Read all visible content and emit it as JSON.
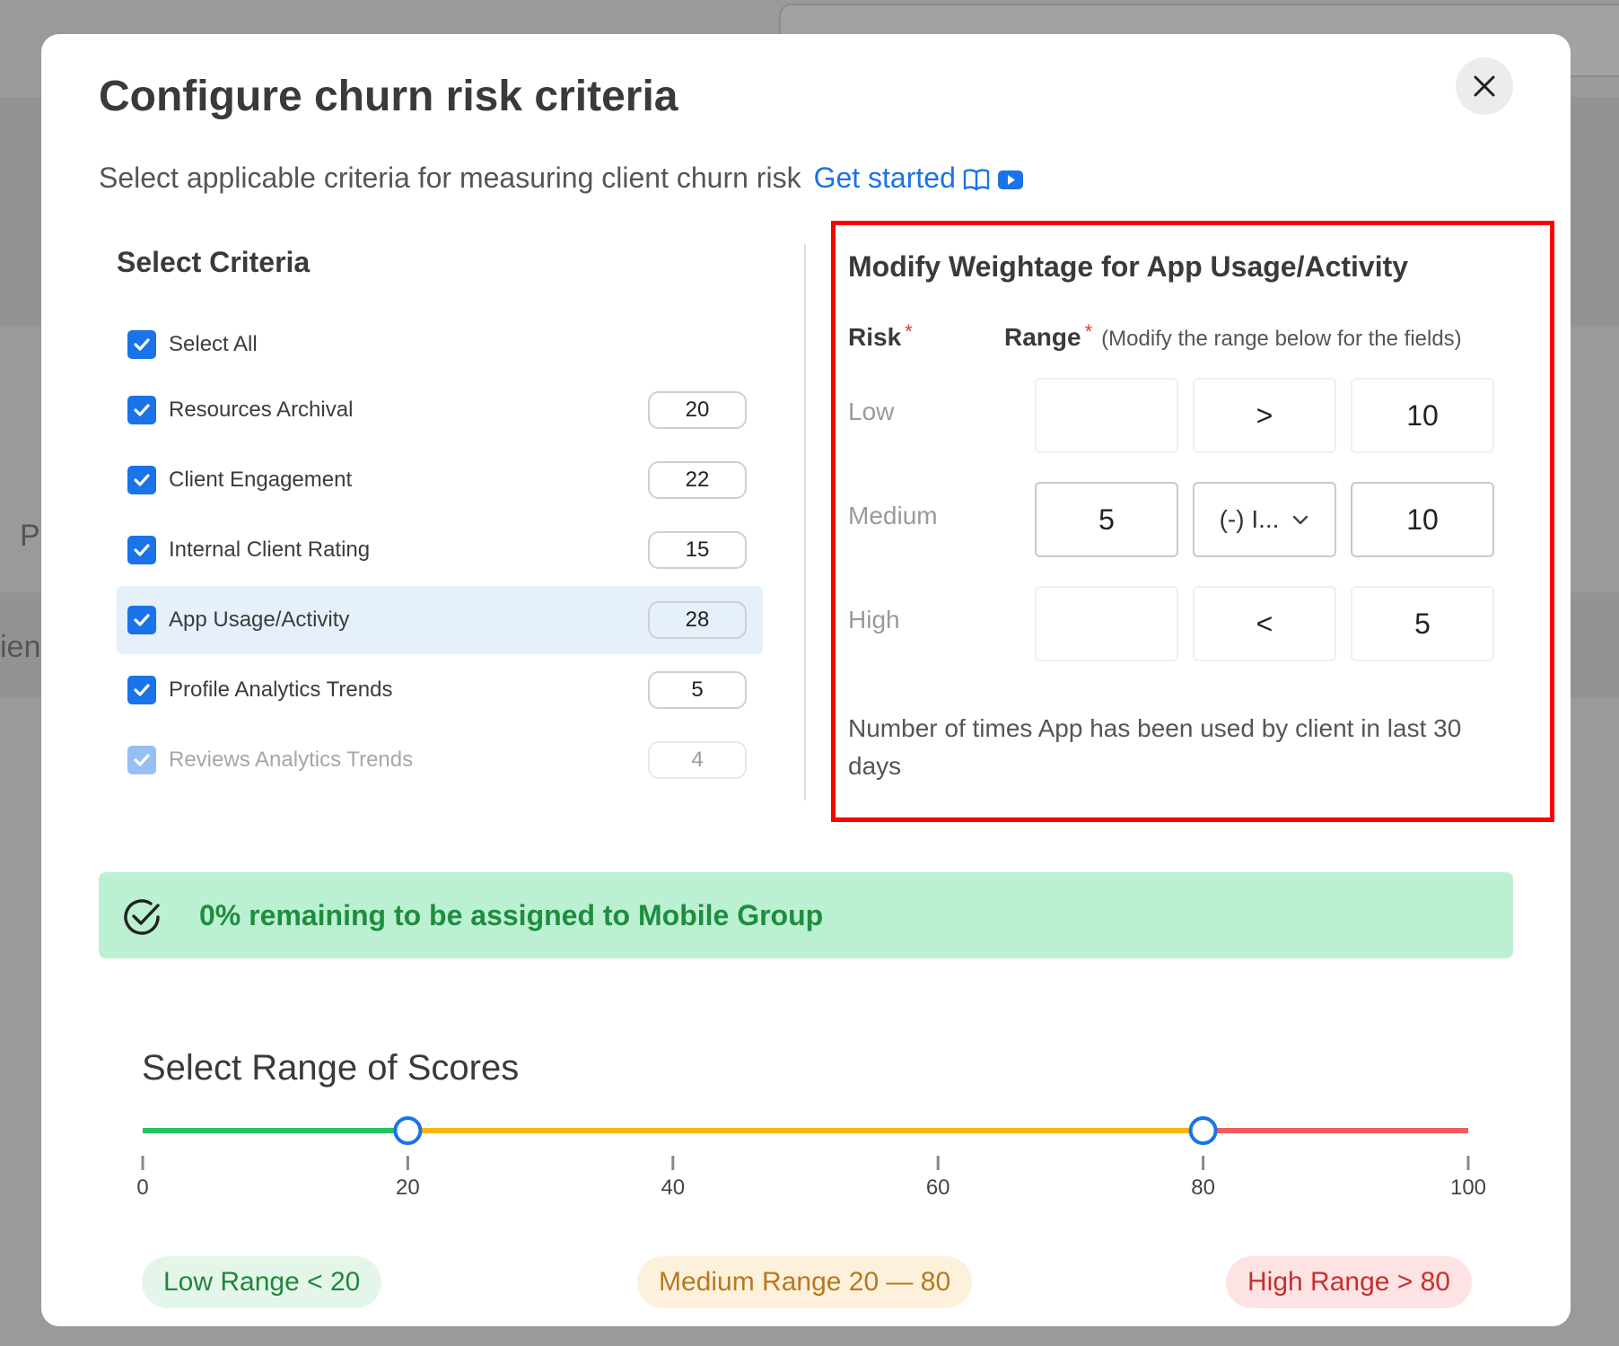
{
  "background": {
    "fragments": [
      "P",
      "ien"
    ]
  },
  "modal": {
    "title": "Configure churn risk criteria",
    "subtitle": "Select applicable criteria for measuring client churn risk",
    "get_started": "Get started",
    "close_icon": "close-icon",
    "book_icon": "book-icon",
    "video_icon": "video-play-icon"
  },
  "criteria": {
    "heading": "Select Criteria",
    "select_all": "Select All",
    "items": [
      {
        "label": "Resources Archival",
        "value": "20",
        "checked": true
      },
      {
        "label": "Client Engagement",
        "value": "22",
        "checked": true
      },
      {
        "label": "Internal Client Rating",
        "value": "15",
        "checked": true
      },
      {
        "label": "App Usage/Activity",
        "value": "28",
        "checked": true,
        "active": true
      },
      {
        "label": "Profile Analytics Trends",
        "value": "5",
        "checked": true
      },
      {
        "label": "Reviews Analytics Trends",
        "value": "4",
        "checked": true,
        "disabled": true
      }
    ]
  },
  "weightage": {
    "title": "Modify Weightage for App Usage/Activity",
    "risk_label": "Risk",
    "range_label": "Range",
    "required_mark": "*",
    "range_hint": "(Modify the range below for the fields)",
    "rows": [
      {
        "risk": "Low",
        "min": "",
        "operator": ">",
        "max": "10"
      },
      {
        "risk": "Medium",
        "min": "5",
        "operator": "(-) I...",
        "max": "10"
      },
      {
        "risk": "High",
        "min": "",
        "operator": "<",
        "max": "5"
      }
    ],
    "description": "Number of times App has been used by client in last 30 days"
  },
  "alert": {
    "text": "0% remaining to be assigned to Mobile Group",
    "icon": "check-circle-icon",
    "color": "#1e8e3e"
  },
  "scores": {
    "heading": "Select Range of Scores",
    "min": 0,
    "max": 100,
    "ticks": [
      "0",
      "20",
      "40",
      "60",
      "80",
      "100"
    ],
    "handles": [
      20,
      80
    ],
    "colors": {
      "low": "#22c55e",
      "medium": "#fbb70f",
      "high": "#f25c5c",
      "handle": "#1a73e8"
    },
    "pills": {
      "low": "Low Range < 20",
      "medium": "Medium Range 20 — 80",
      "high": "High Range > 80"
    }
  }
}
